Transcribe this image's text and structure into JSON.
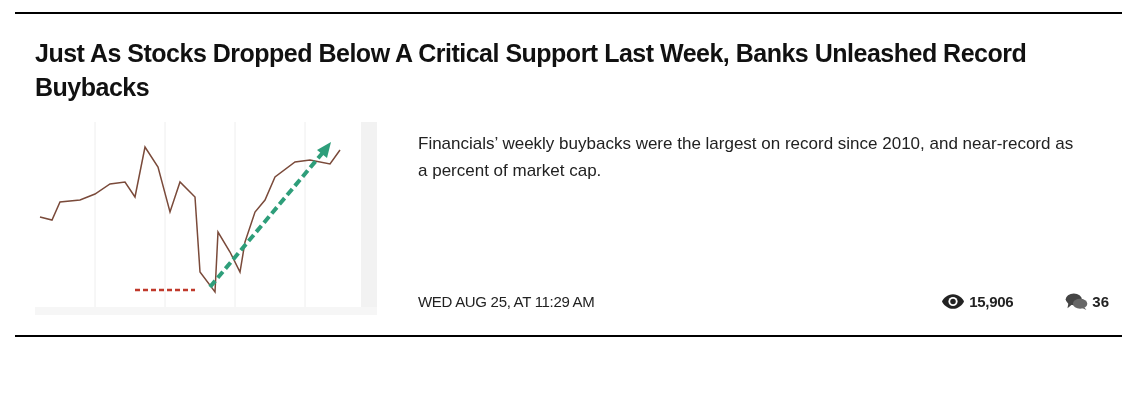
{
  "article": {
    "title": "Just As Stocks Dropped Below A Critical Support Last Week, Banks Unleashed Record Buybacks",
    "summary": "Financials’ weekly buybacks were the largest on record since 2010, and near-record as a percent of market cap.",
    "date": "WED AUG 25, AT 11:29 AM",
    "views": "15,906",
    "comments": "36"
  }
}
